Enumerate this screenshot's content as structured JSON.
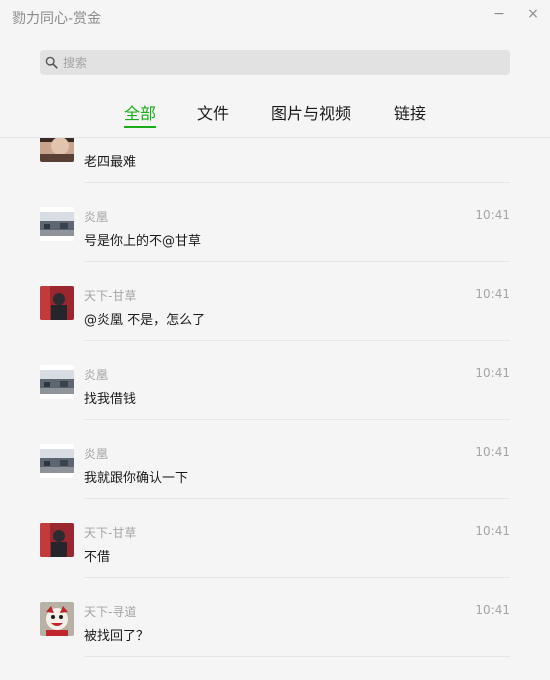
{
  "window": {
    "title": "勠力同心-赏金",
    "minimize": "−",
    "close": "×"
  },
  "search": {
    "placeholder": "搜索",
    "value": ""
  },
  "tabs": [
    {
      "label": "全部",
      "active": true
    },
    {
      "label": "文件",
      "active": false
    },
    {
      "label": "图片与视频",
      "active": false
    },
    {
      "label": "链接",
      "active": false
    }
  ],
  "messages": [
    {
      "sender": "",
      "time": "",
      "text": "老四最难",
      "avatar": "photo-avatar"
    },
    {
      "sender": "炎凰",
      "time": "10:41",
      "text": "号是你上的不@甘草",
      "avatar": "landscape-avatar"
    },
    {
      "sender": "天下-甘草",
      "time": "10:41",
      "text": "@炎凰 不是，怎么了",
      "avatar": "red-portrait-avatar"
    },
    {
      "sender": "炎凰",
      "time": "10:41",
      "text": "找我借钱",
      "avatar": "landscape-avatar"
    },
    {
      "sender": "炎凰",
      "time": "10:41",
      "text": "我就跟你确认一下",
      "avatar": "landscape-avatar"
    },
    {
      "sender": "天下-甘草",
      "time": "10:41",
      "text": "不借",
      "avatar": "red-portrait-avatar"
    },
    {
      "sender": "天下-寻道",
      "time": "10:41",
      "text": "被找回了？",
      "avatar": "clown-avatar"
    }
  ],
  "colors": {
    "accent": "#1aad19",
    "background": "#f5f5f5",
    "muted_text": "#a5a5a5"
  }
}
